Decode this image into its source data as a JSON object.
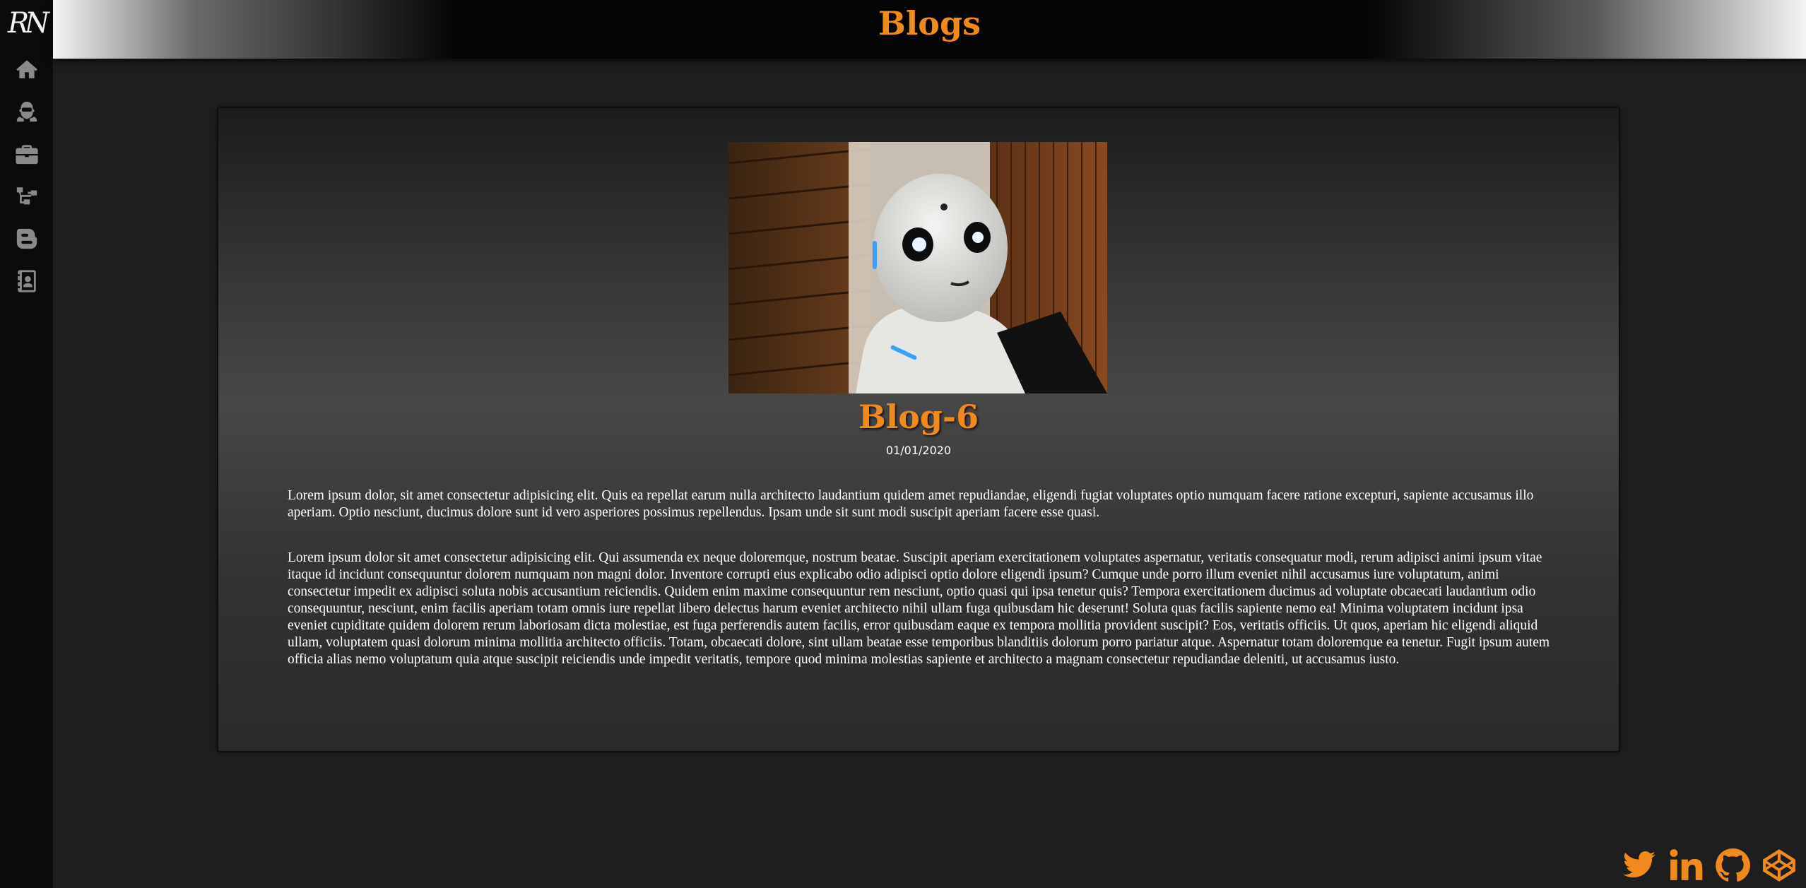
{
  "header": {
    "title": "Blogs"
  },
  "logo": {
    "text": "RN"
  },
  "sidebar": {
    "items": [
      {
        "name": "home",
        "icon": "home-icon"
      },
      {
        "name": "about",
        "icon": "user-astronaut-icon"
      },
      {
        "name": "work",
        "icon": "briefcase-icon"
      },
      {
        "name": "projects",
        "icon": "sitemap-icon"
      },
      {
        "name": "blogs",
        "icon": "blogger-icon"
      },
      {
        "name": "contact",
        "icon": "address-book-icon"
      }
    ]
  },
  "blog": {
    "image_alt": "robot",
    "title": "Blog-6",
    "date": "01/01/2020",
    "paragraphs": [
      "Lorem ipsum dolor, sit amet consectetur adipisicing elit. Quis ea repellat earum nulla architecto laudantium quidem amet repudiandae, eligendi fugiat voluptates optio numquam facere ratione excepturi, sapiente accusamus illo aperiam. Optio nesciunt, ducimus dolore sunt id vero asperiores possimus repellendus. Ipsam unde sit sunt modi suscipit aperiam facere esse quasi.",
      "Lorem ipsum dolor sit amet consectetur adipisicing elit. Qui assumenda ex neque doloremque, nostrum beatae. Suscipit aperiam exercitationem voluptates aspernatur, veritatis consequatur modi, rerum adipisci animi ipsum vitae itaque id incidunt consequuntur dolorem numquam non magni dolor. Inventore corrupti eius explicabo odio adipisci optio dolore eligendi ipsum? Cumque unde porro illum eveniet nihil accusamus iure voluptatum, animi consectetur impedit ex adipisci soluta nobis accusantium reiciendis. Quidem enim maxime consequuntur rem nesciunt, optio quasi qui ipsa tenetur quis? Tempora exercitationem ducimus ad voluptate obcaecati laudantium odio consequuntur, nesciunt, enim facilis aperiam totam omnis iure repellat libero delectus harum eveniet architecto nihil ullam fuga quibusdam hic deserunt! Soluta quas facilis sapiente nemo ea! Minima voluptatem incidunt ipsa eveniet cupiditate quidem dolorem rerum laboriosam dicta molestiae, est fuga perferendis autem facilis, error quibusdam eaque ex tempora mollitia provident suscipit? Eos, veritatis officiis. Ut quos, aperiam hic eligendi aliquid ullam, voluptatem quasi dolorum minima mollitia architecto officiis. Totam, obcaecati dolore, sint ullam beatae esse temporibus blanditiis dolorum porro pariatur atque. Aspernatur totam doloremque ea tenetur. Fugit ipsum autem officia alias nemo voluptatum quia atque suscipit reiciendis unde impedit veritatis, tempore quod minima molestias sapiente et architecto a magnam consectetur repudiandae deleniti, ut accusamus iusto."
    ]
  },
  "social": [
    {
      "name": "twitter",
      "icon": "twitter-icon"
    },
    {
      "name": "linkedin",
      "icon": "linkedin-icon"
    },
    {
      "name": "github",
      "icon": "github-icon"
    },
    {
      "name": "codepen",
      "icon": "codepen-icon"
    }
  ],
  "colors": {
    "accent": "#f08a1c",
    "sidebar_bg": "#0b0b0b",
    "icon_gray": "#8a8a8a",
    "page_bg": "#1e1e1e"
  }
}
